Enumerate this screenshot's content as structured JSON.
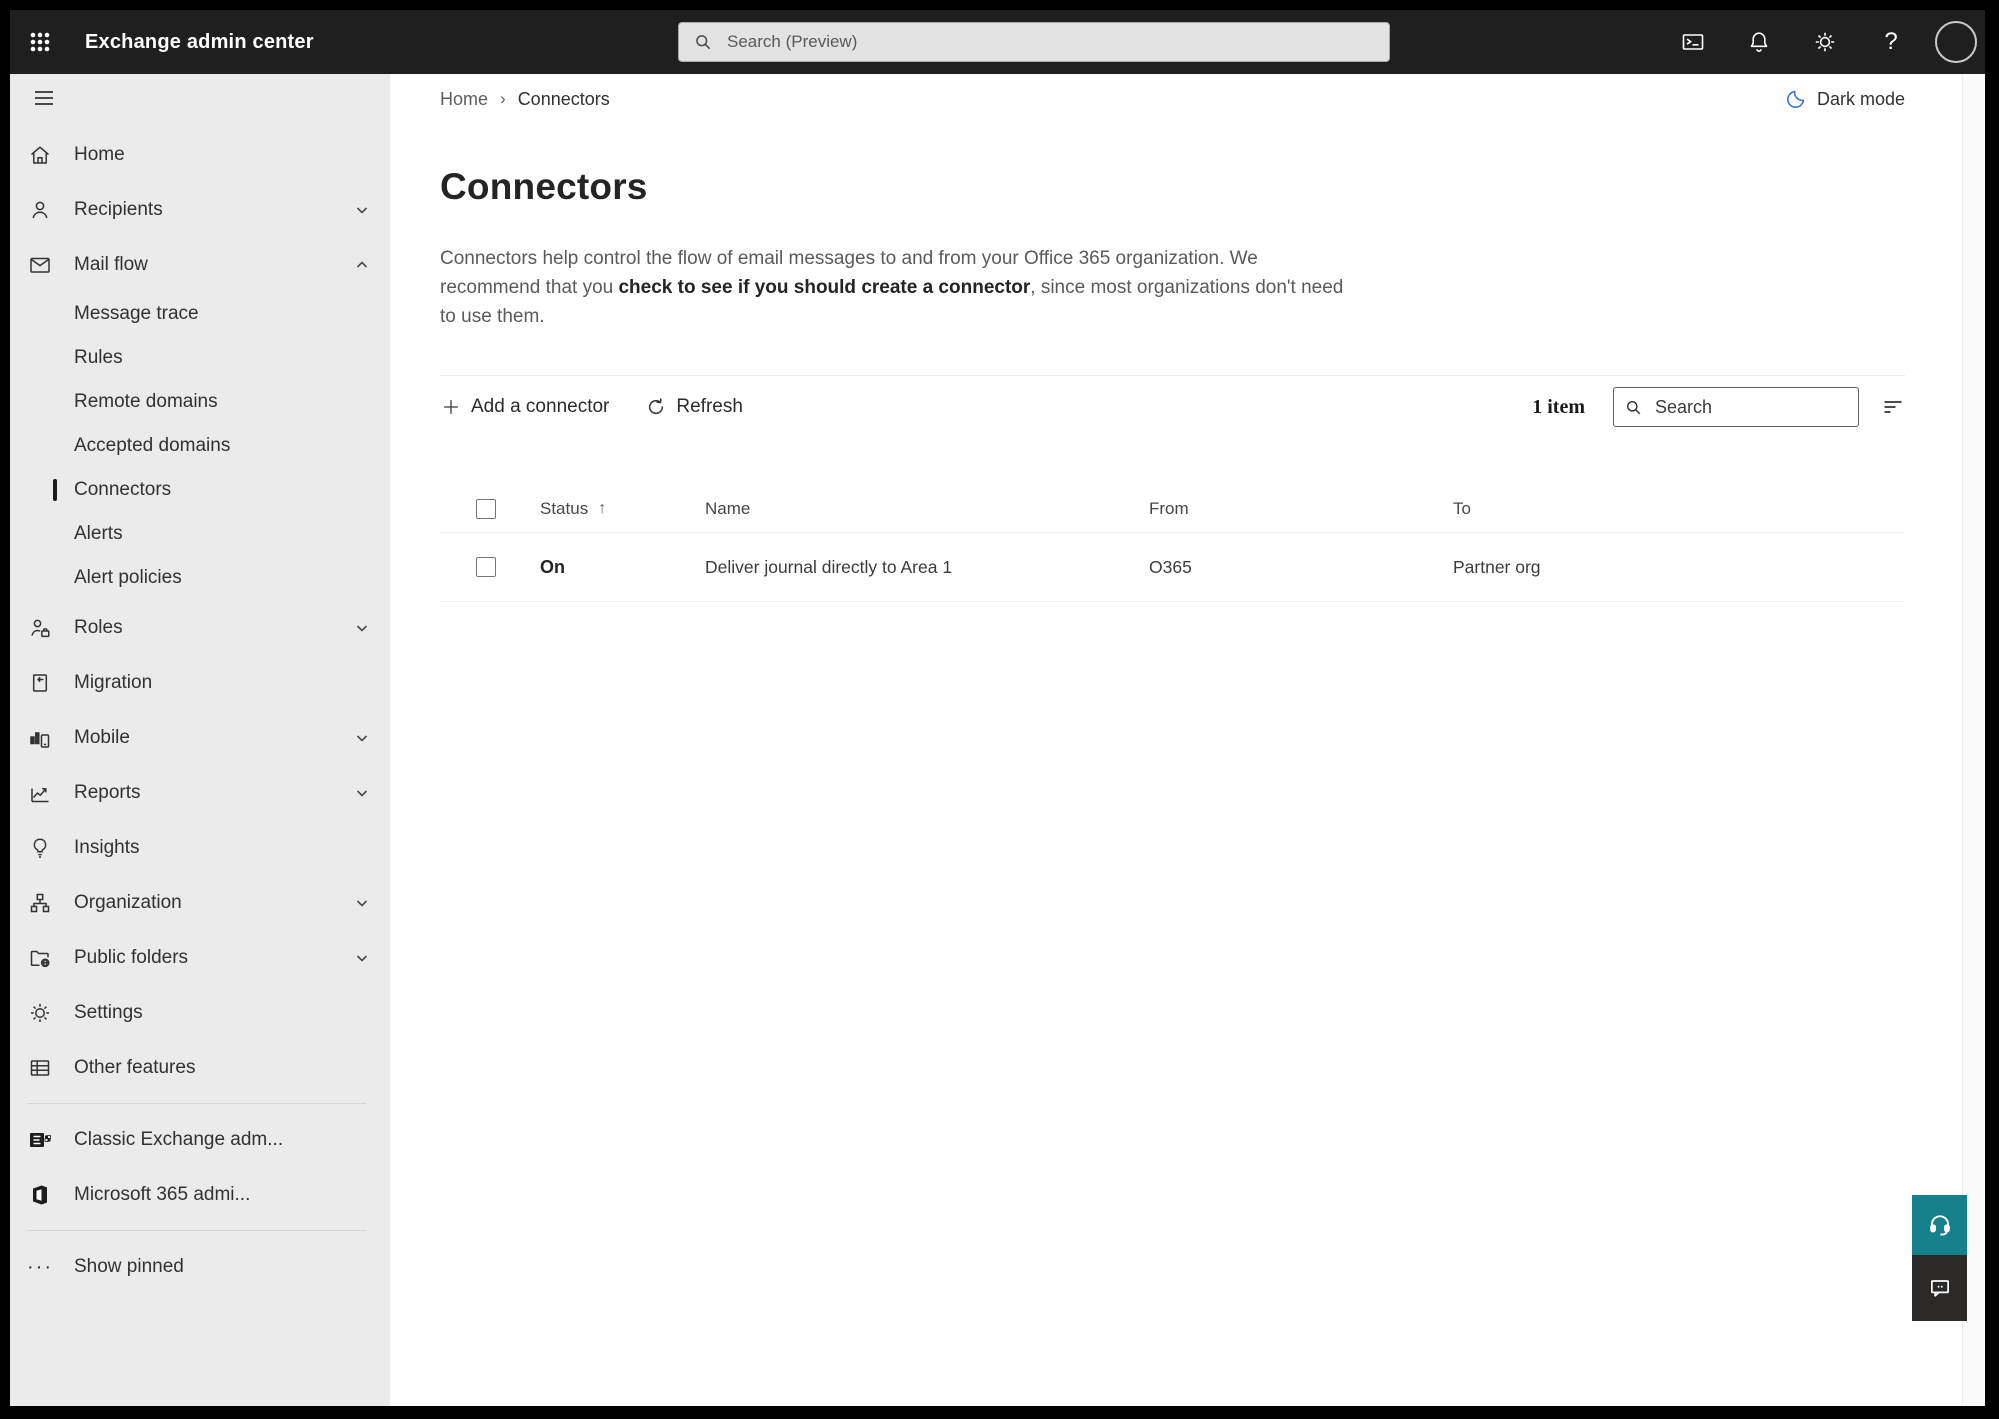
{
  "topbar": {
    "title": "Exchange admin center",
    "search_placeholder": "Search (Preview)"
  },
  "glyphs": {
    "help": "?",
    "show_pinned_ellipsis": "···",
    "sort_ascending": "↑",
    "breadcrumb_separator": "›"
  },
  "breadcrumb": {
    "items": [
      "Home",
      "Connectors"
    ]
  },
  "theme_toggle": {
    "label": "Dark mode"
  },
  "sidebar": {
    "selected": "Connectors",
    "items": [
      {
        "label": "Home"
      },
      {
        "label": "Recipients"
      },
      {
        "label": "Mail flow"
      },
      {
        "label": "Message trace"
      },
      {
        "label": "Rules"
      },
      {
        "label": "Remote domains"
      },
      {
        "label": "Accepted domains"
      },
      {
        "label": "Connectors"
      },
      {
        "label": "Alerts"
      },
      {
        "label": "Alert policies"
      },
      {
        "label": "Roles"
      },
      {
        "label": "Migration"
      },
      {
        "label": "Mobile"
      },
      {
        "label": "Reports"
      },
      {
        "label": "Insights"
      },
      {
        "label": "Organization"
      },
      {
        "label": "Public folders"
      },
      {
        "label": "Settings"
      },
      {
        "label": "Other features"
      },
      {
        "label": "Classic Exchange adm..."
      },
      {
        "label": "Microsoft 365 admi..."
      },
      {
        "label": "Show pinned"
      }
    ]
  },
  "page": {
    "title": "Connectors",
    "description": {
      "part1": "Connectors help control the flow of email messages to and from your Office 365 organization. We recommend that you ",
      "emphasis": "check to see if you should create a connector",
      "part2": ", since most organizations don't need to use them."
    }
  },
  "toolbar": {
    "add_button": "Add a connector",
    "refresh_button": "Refresh",
    "item_count": "1 item",
    "search_placeholder": "Search"
  },
  "table": {
    "columns": [
      "Status",
      "Name",
      "From",
      "To"
    ],
    "sorted_column": "Status",
    "sort_direction": "ascending",
    "rows": [
      {
        "status": "On",
        "name": "Deliver journal directly to Area 1",
        "from": "O365",
        "to": "Partner org"
      }
    ]
  },
  "colors": {
    "topbar_bg": "#1f1f1f",
    "sidebar_bg": "#ebebeb",
    "support_teal": "#16808d",
    "feedback_dark": "#2b2a29",
    "moon_blue": "#3d6fd6",
    "text_dark": "#242424",
    "text_gray": "#5a5a5a"
  }
}
